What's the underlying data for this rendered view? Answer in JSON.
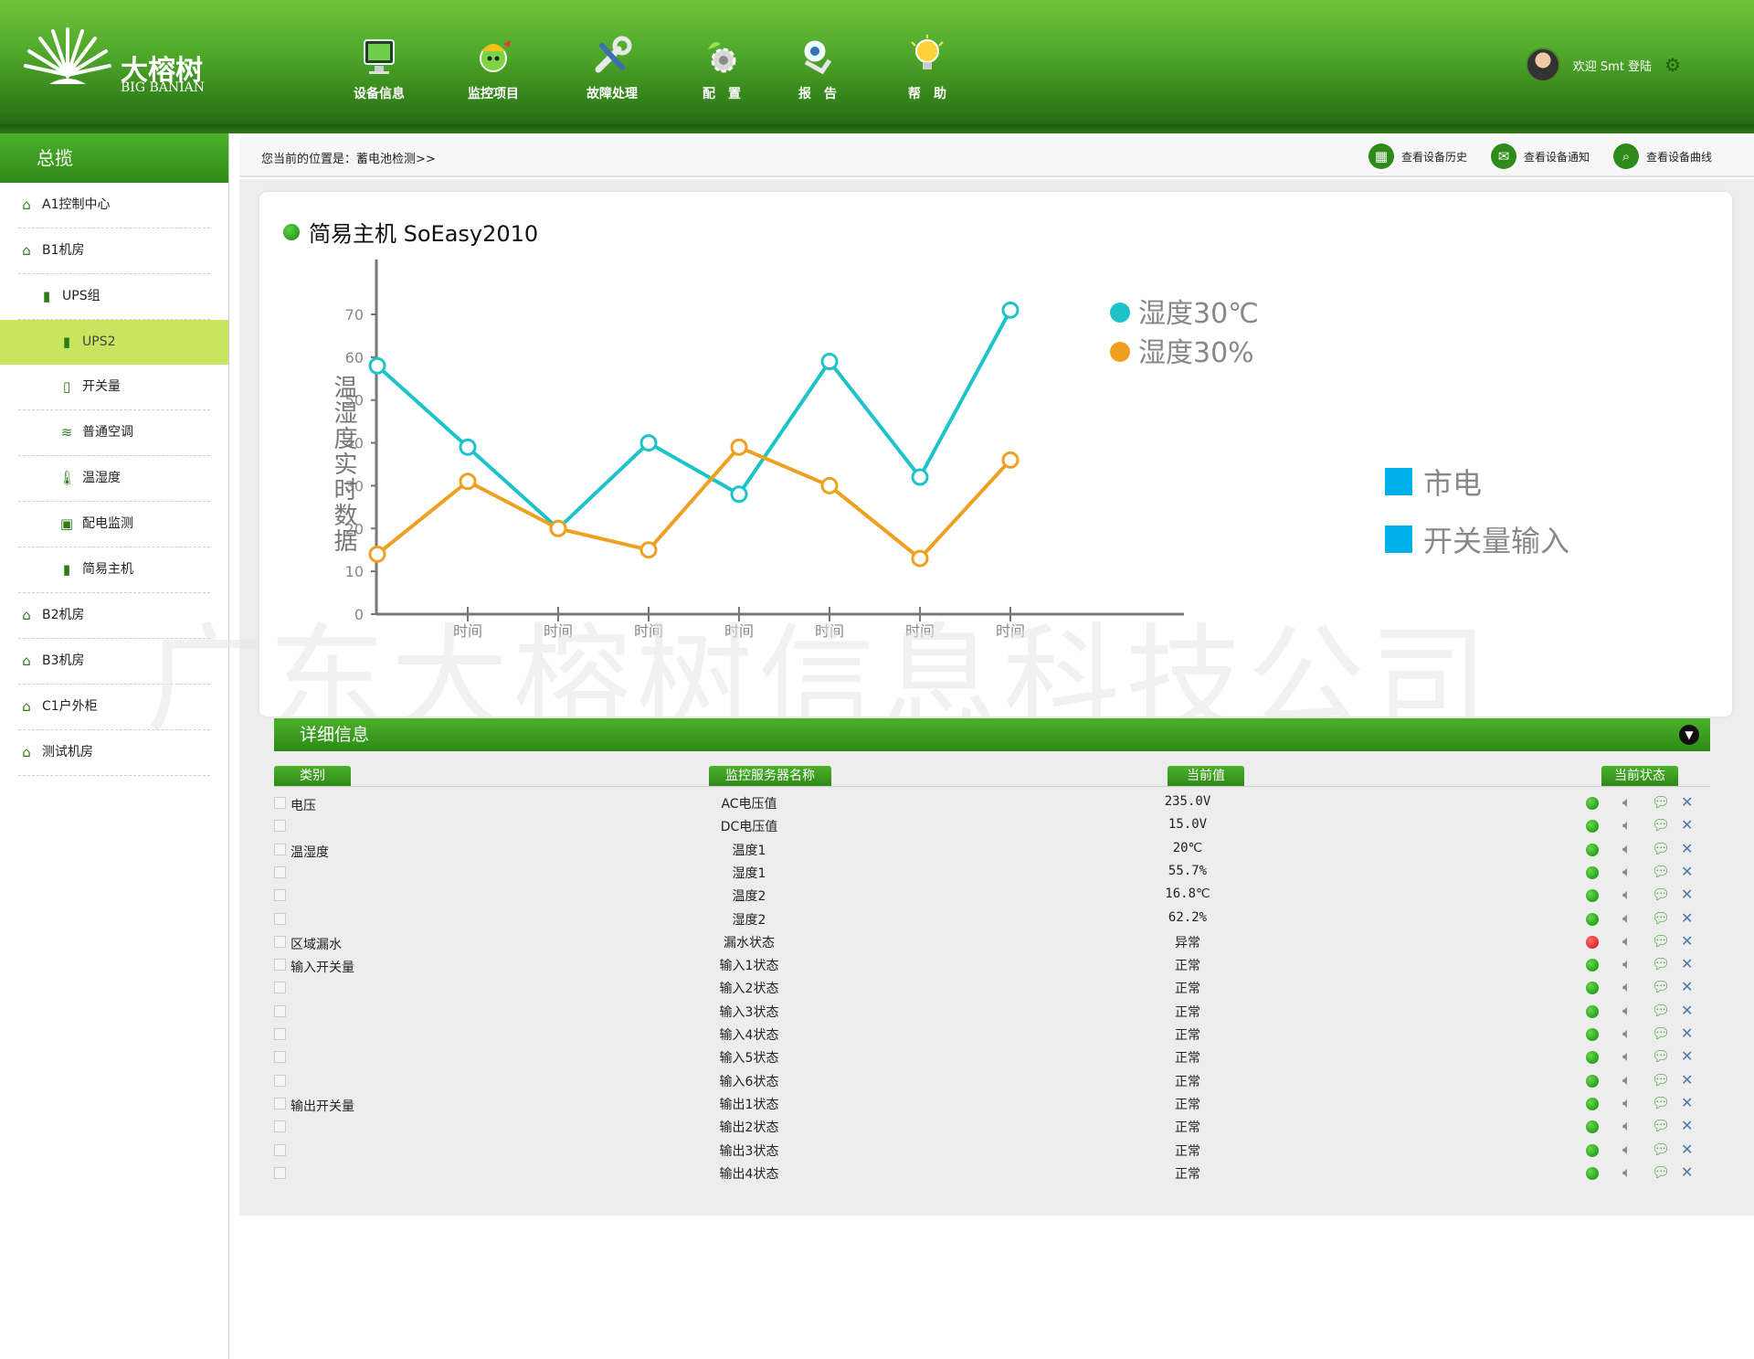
{
  "brand": {
    "name": "大榕树",
    "sub": "BIG BANIAN"
  },
  "nav": [
    {
      "label": "设备信息",
      "icon": "monitor-icon"
    },
    {
      "label": "监控项目",
      "icon": "monitor-project-icon"
    },
    {
      "label": "故障处理",
      "icon": "wrench-icon"
    },
    {
      "label": "配　置",
      "icon": "config-gear-icon"
    },
    {
      "label": "报　告",
      "icon": "report-icon"
    },
    {
      "label": "帮　助",
      "icon": "lightbulb-icon"
    }
  ],
  "user": {
    "welcome": "欢迎 Smt 登陆"
  },
  "sidebar": {
    "title": "总揽",
    "items": [
      {
        "label": "A1控制中心",
        "icon": "home-icon",
        "level": 1
      },
      {
        "label": "B1机房",
        "icon": "home-icon",
        "level": 1
      },
      {
        "label": "UPS组",
        "icon": "device-icon",
        "level": 2
      },
      {
        "label": "UPS2",
        "icon": "device-icon",
        "level": 3,
        "active": true
      },
      {
        "label": "开关量",
        "icon": "switch-icon",
        "level": 3
      },
      {
        "label": "普通空调",
        "icon": "aircon-icon",
        "level": 3
      },
      {
        "label": "温湿度",
        "icon": "thermometer-icon",
        "level": 3
      },
      {
        "label": "配电监测",
        "icon": "power-monitor-icon",
        "level": 3
      },
      {
        "label": "简易主机",
        "icon": "device-icon",
        "level": 3
      },
      {
        "label": "B2机房",
        "icon": "home-icon",
        "level": 1
      },
      {
        "label": "B3机房",
        "icon": "home-icon",
        "level": 1
      },
      {
        "label": "C1户外柜",
        "icon": "home-icon",
        "level": 1
      },
      {
        "label": "测试机房",
        "icon": "home-icon",
        "level": 1
      }
    ]
  },
  "breadcrumb": "您当前的位置是：蓄电池检测>>",
  "toolbar": {
    "history": "查看设备历史",
    "notice": "查看设备通知",
    "curve": "查看设备曲线"
  },
  "card": {
    "title": "简易主机 SoEasy2010"
  },
  "chart_data": {
    "type": "line",
    "ylabel": "温湿度实时数据",
    "ylim": [
      0,
      70
    ],
    "yticks": [
      0,
      10,
      20,
      30,
      40,
      50,
      60,
      70
    ],
    "x": [
      0,
      1,
      2,
      3,
      4,
      5,
      6,
      7
    ],
    "xticklabels": [
      "时间",
      "时间",
      "时间",
      "时间",
      "时间",
      "时间",
      "时间"
    ],
    "series": [
      {
        "name": "湿度30℃",
        "color": "#1cc3c8",
        "values": [
          58,
          39,
          20,
          40,
          28,
          59,
          32,
          71
        ]
      },
      {
        "name": "湿度30%",
        "color": "#f0a020",
        "values": [
          14,
          31,
          20,
          15,
          39,
          30,
          13,
          36
        ]
      }
    ],
    "extra_legend": [
      {
        "label": "市电",
        "color": "#00b0e8"
      },
      {
        "label": "开关量输入",
        "color": "#00b0e8"
      }
    ]
  },
  "watermark": "广东大榕树信息科技公司",
  "detail": {
    "title": "详细信息",
    "headers": {
      "category": "类别",
      "name": "监控服务器名称",
      "value": "当前值",
      "status": "当前状态"
    },
    "rows": [
      {
        "category": "电压",
        "name": "AC电压值",
        "value": "235.0V",
        "status": "ok"
      },
      {
        "category": "",
        "name": "DC电压值",
        "value": "15.0V",
        "status": "ok"
      },
      {
        "category": "温湿度",
        "name": "温度1",
        "value": "20℃",
        "status": "ok"
      },
      {
        "category": "",
        "name": "湿度1",
        "value": "55.7%",
        "status": "ok"
      },
      {
        "category": "",
        "name": "温度2",
        "value": "16.8℃",
        "status": "ok"
      },
      {
        "category": "",
        "name": "湿度2",
        "value": "62.2%",
        "status": "ok"
      },
      {
        "category": "区域漏水",
        "name": "漏水状态",
        "value": "异常",
        "status": "bad"
      },
      {
        "category": "输入开关量",
        "name": "输入1状态",
        "value": "正常",
        "status": "ok"
      },
      {
        "category": "",
        "name": "输入2状态",
        "value": "正常",
        "status": "ok"
      },
      {
        "category": "",
        "name": "输入3状态",
        "value": "正常",
        "status": "ok"
      },
      {
        "category": "",
        "name": "输入4状态",
        "value": "正常",
        "status": "ok"
      },
      {
        "category": "",
        "name": "输入5状态",
        "value": "正常",
        "status": "ok"
      },
      {
        "category": "",
        "name": "输入6状态",
        "value": "正常",
        "status": "ok"
      },
      {
        "category": "输出开关量",
        "name": "输出1状态",
        "value": "正常",
        "status": "ok"
      },
      {
        "category": "",
        "name": "输出2状态",
        "value": "正常",
        "status": "ok"
      },
      {
        "category": "",
        "name": "输出3状态",
        "value": "正常",
        "status": "ok"
      },
      {
        "category": "",
        "name": "输出4状态",
        "value": "正常",
        "status": "ok"
      }
    ]
  }
}
